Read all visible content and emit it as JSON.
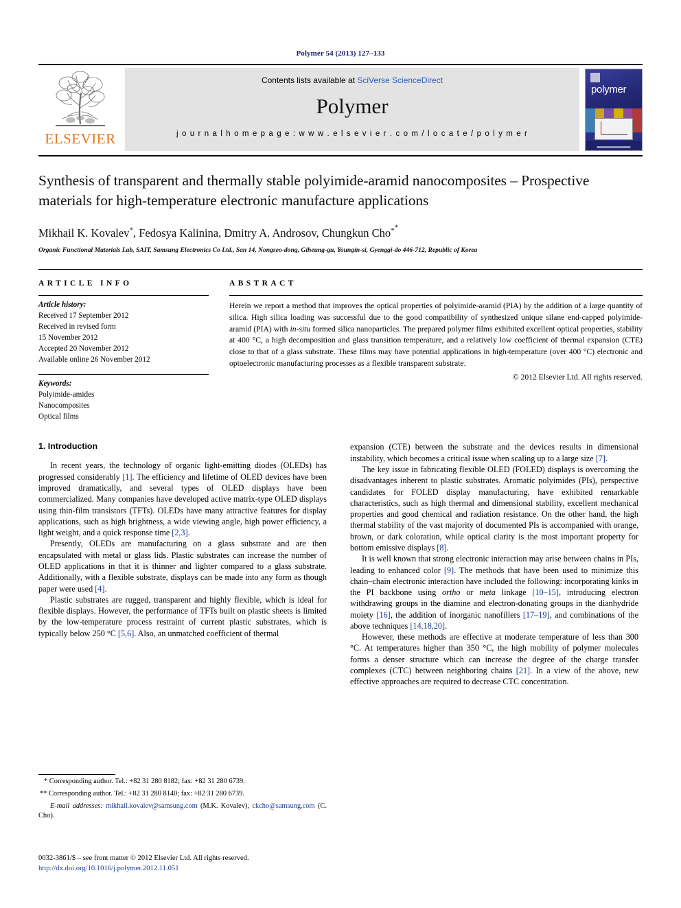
{
  "running_head": "Polymer 54 (2013) 127–133",
  "masthead": {
    "publisher_name": "ELSEVIER",
    "contents_prefix": "Contents lists available at ",
    "contents_link": "SciVerse ScienceDirect",
    "journal_name": "Polymer",
    "homepage": "j o u r n a l   h o m e p a g e :   w w w . e l s e v i e r . c o m / l o c a t e / p o l y m e r",
    "cover_title": "polymer",
    "link_color": "#2a5bbf"
  },
  "article": {
    "title": "Synthesis of transparent and thermally stable polyimide-aramid nanocomposites – Prospective materials for high-temperature electronic manufacture applications",
    "authors": "Mikhail K. Kovalev",
    "authors_full": "Mikhail K. Kovalev*, Fedosya Kalinina, Dmitry A. Androsov, Chungkun Cho**",
    "author_list": [
      {
        "name": "Mikhail K. Kovalev",
        "marker": "*"
      },
      {
        "name": "Fedosya Kalinina",
        "marker": ""
      },
      {
        "name": "Dmitry A. Androsov",
        "marker": ""
      },
      {
        "name": "Chungkun Cho",
        "marker": "**"
      }
    ],
    "affiliation": "Organic Functional Materials Lab, SAIT, Samsung Electronics Co Ltd., San 14, Nongseo-dong, Giheung-gu, Youngin-si, Gyenggi-do 446-712, Republic of Korea"
  },
  "info": {
    "heading": "ARTICLE INFO",
    "history_label": "Article history:",
    "history": [
      "Received 17 September 2012",
      "Received in revised form",
      "15 November 2012",
      "Accepted 20 November 2012",
      "Available online 26 November 2012"
    ],
    "keywords_label": "Keywords:",
    "keywords": [
      "Polyimide-amides",
      "Nanocomposites",
      "Optical films"
    ]
  },
  "abstract": {
    "heading": "ABSTRACT",
    "text": "Herein we report a method that improves the optical properties of polyimide-aramid (PIA) by the addition of a large quantity of silica. High silica loading was successful due to the good compatibility of synthesized unique silane end-capped polyimide-aramid (PIA) with in-situ formed silica nanoparticles. The prepared polymer films exhibited excellent optical properties, stability at 400 °C, a high decomposition and glass transition temperature, and a relatively low coefficient of thermal expansion (CTE) close to that of a glass substrate. These films may have potential applications in high-temperature (over 400 °C) electronic and optoelectronic manufacturing processes as a flexible transparent substrate.",
    "copyright": "© 2012 Elsevier Ltd. All rights reserved."
  },
  "body": {
    "section_title": "1.  Introduction",
    "left_paragraphs": [
      "In recent years, the technology of organic light-emitting diodes (OLEDs) has progressed considerably [1]. The efficiency and lifetime of OLED devices have been improved dramatically, and several types of OLED displays have been commercialized. Many companies have developed active matrix-type OLED displays using thin-film transistors (TFTs). OLEDs have many attractive features for display applications, such as high brightness, a wide viewing angle, high power efficiency, a light weight, and a quick response time [2,3].",
      "Presently, OLEDs are manufacturing on a glass substrate and are then encapsulated with metal or glass lids. Plastic substrates can increase the number of OLED applications in that it is thinner and lighter compared to a glass substrate. Additionally, with a flexible substrate, displays can be made into any form as though paper were used [4].",
      "Plastic substrates are rugged, transparent and highly flexible, which is ideal for flexible displays. However, the performance of TFTs built on plastic sheets is limited by the low-temperature process restraint of current plastic substrates, which is typically below 250 °C [5,6]. Also, an unmatched coefficient of thermal"
    ],
    "right_paragraphs": [
      "expansion (CTE) between the substrate and the devices results in dimensional instability, which becomes a critical issue when scaling up to a large size [7].",
      "The key issue in fabricating flexible OLED (FOLED) displays is overcoming the disadvantages inherent to plastic substrates. Aromatic polyimides (PIs), perspective candidates for FOLED display manufacturing, have exhibited remarkable characteristics, such as high thermal and dimensional stability, excellent mechanical properties and good chemical and radiation resistance. On the other hand, the high thermal stability of the vast majority of documented PIs is accompanied with orange, brown, or dark coloration, while optical clarity is the most important property for bottom emissive displays [8].",
      "It is well known that strong electronic interaction may arise between chains in PIs, leading to enhanced color [9]. The methods that have been used to minimize this chain–chain electronic interaction have included the following: incorporating kinks in the PI backbone using ortho or meta linkage [10–15], introducing electron withdrawing groups in the diamine and electron-donating groups in the dianhydride moiety [16], the addition of inorganic nanofillers [17–19], and combinations of the above techniques [14,18,20].",
      "However, these methods are effective at moderate temperature of less than 300 °C. At temperatures higher than 350 °C, the high mobility of polymer molecules forms a denser structure which can increase the degree of the charge transfer complexes (CTC) between neighboring chains [21]. In a view of the above, new effective approaches are required to decrease CTC concentration."
    ]
  },
  "footnotes": {
    "first": "* Corresponding author. Tel.: +82 31 280 8182; fax: +82 31 280 6739.",
    "second": "** Corresponding author. Tel.: +82 31 280 8140; fax: +82 31 280 6739.",
    "email_label": "E-mail addresses:",
    "email_1": "mikhail.kovalev@samsung.com",
    "email_1_who": "(M.K. Kovalev),",
    "email_2": "ckcho@samsung.com",
    "email_2_who": "(C. Cho)."
  },
  "footer": {
    "issn_line": "0032-3861/$ – see front matter © 2012 Elsevier Ltd. All rights reserved.",
    "doi": "http://dx.doi.org/10.1016/j.polymer.2012.11.051"
  }
}
